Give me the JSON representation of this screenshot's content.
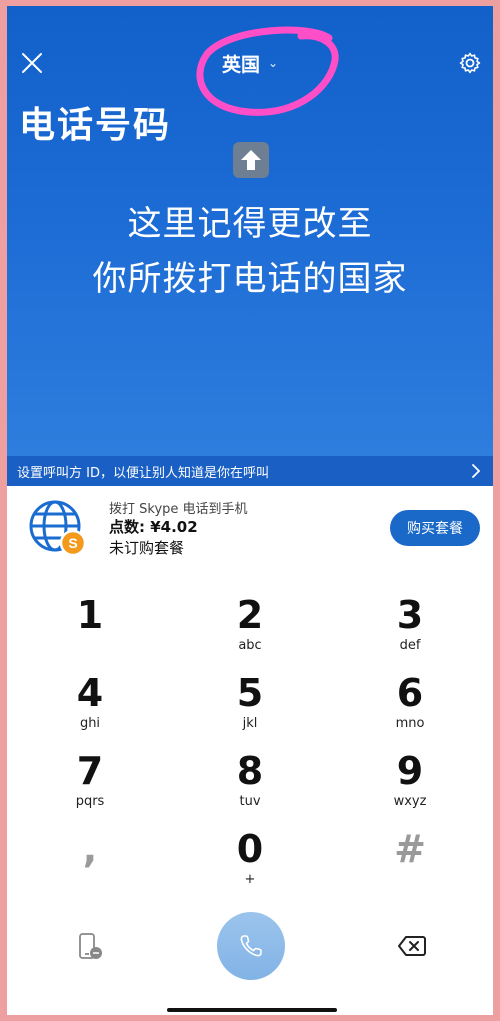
{
  "header": {
    "country": "英国",
    "annotation_title": "电话号码",
    "annotation_line1": "这里记得更改至",
    "annotation_line2": "你所拨打电话的国家"
  },
  "caller_id_bar": {
    "text": "设置呼叫方 ID，以便让别人知道是你在呼叫"
  },
  "credit": {
    "subtitle": "拨打 Skype 电话到手机",
    "balance": "点数: ¥4.02",
    "plan": "未订购套餐",
    "buy_label": "购买套餐"
  },
  "dialpad": {
    "keys": [
      {
        "num": "1",
        "letters": ""
      },
      {
        "num": "2",
        "letters": "abc"
      },
      {
        "num": "3",
        "letters": "def"
      },
      {
        "num": "4",
        "letters": "ghi"
      },
      {
        "num": "5",
        "letters": "jkl"
      },
      {
        "num": "6",
        "letters": "mno"
      },
      {
        "num": "7",
        "letters": "pqrs"
      },
      {
        "num": "8",
        "letters": "tuv"
      },
      {
        "num": "9",
        "letters": "wxyz"
      },
      {
        "num": ",",
        "letters": ""
      },
      {
        "num": "0",
        "letters": "+"
      },
      {
        "num": "#",
        "letters": ""
      }
    ]
  },
  "colors": {
    "header_blue": "#1260c9",
    "caller_id_blue": "#1a5fc4",
    "accent_button": "#1a68c7",
    "annotation_pink": "#ff4fc8",
    "call_button": "#8ab9e9"
  },
  "icons": {
    "close": "close-icon",
    "settings": "gear-icon",
    "globe": "globe-icon",
    "phone": "phone-icon",
    "backspace": "backspace-icon",
    "sms": "phone-sms-icon"
  }
}
